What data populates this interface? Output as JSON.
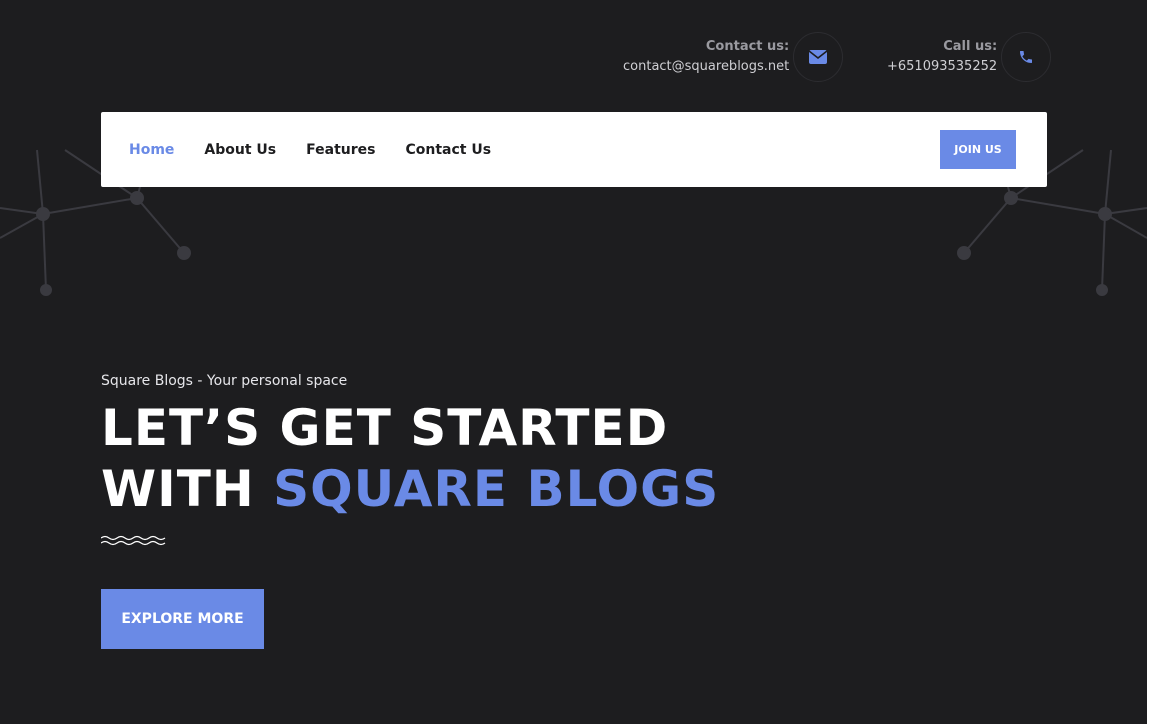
{
  "header": {
    "contact_email": {
      "label": "Contact us:",
      "value": "contact@squareblogs.net",
      "icon": "envelope-icon"
    },
    "contact_phone": {
      "label": "Call us:",
      "value": "+651093535252",
      "icon": "phone-icon"
    }
  },
  "nav": {
    "items": [
      {
        "label": "Home",
        "active": true
      },
      {
        "label": "About Us",
        "active": false
      },
      {
        "label": "Features",
        "active": false
      },
      {
        "label": "Contact Us",
        "active": false
      }
    ],
    "join_label": "JOIN US"
  },
  "hero": {
    "subtitle": "Square Blogs - Your personal space",
    "title_line1": "LET’S GET STARTED",
    "title_line2_prefix": "WITH ",
    "title_line2_accent": "SQUARE BLOGS",
    "cta_label": "EXPLORE MORE"
  },
  "colors": {
    "background": "#1d1d1f",
    "accent": "#6a8ae6",
    "navbar": "#ffffff"
  }
}
